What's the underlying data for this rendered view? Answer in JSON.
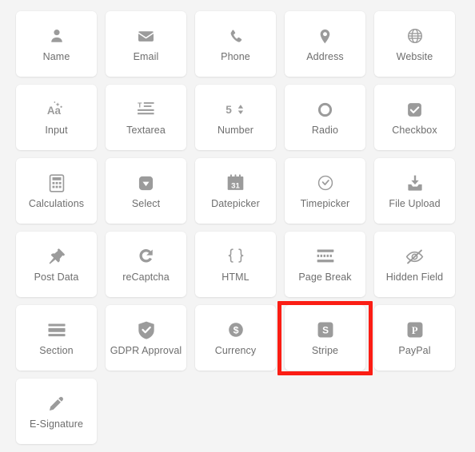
{
  "palette": {
    "page_background": "#f4f4f4",
    "card_background": "#ffffff",
    "icon_color": "#9b9b9b",
    "label_color": "#6e6e6e",
    "highlight_color": "#fb1d14"
  },
  "grid": {
    "columns": 5,
    "fields": [
      {
        "label": "Name",
        "icon": "person-icon"
      },
      {
        "label": "Email",
        "icon": "envelope-icon"
      },
      {
        "label": "Phone",
        "icon": "phone-icon"
      },
      {
        "label": "Address",
        "icon": "map-pin-icon"
      },
      {
        "label": "Website",
        "icon": "globe-icon"
      },
      {
        "label": "Input",
        "icon": "text-aa-icon"
      },
      {
        "label": "Textarea",
        "icon": "text-lines-icon"
      },
      {
        "label": "Number",
        "icon": "number-spinner-icon"
      },
      {
        "label": "Radio",
        "icon": "radio-circle-icon"
      },
      {
        "label": "Checkbox",
        "icon": "checkbox-icon"
      },
      {
        "label": "Calculations",
        "icon": "calculator-icon"
      },
      {
        "label": "Select",
        "icon": "dropdown-caret-icon"
      },
      {
        "label": "Datepicker",
        "icon": "calendar-31-icon"
      },
      {
        "label": "Timepicker",
        "icon": "clock-icon"
      },
      {
        "label": "File Upload",
        "icon": "upload-tray-icon"
      },
      {
        "label": "Post Data",
        "icon": "pushpin-icon"
      },
      {
        "label": "reCaptcha",
        "icon": "refresh-arrow-icon"
      },
      {
        "label": "HTML",
        "icon": "curly-braces-icon"
      },
      {
        "label": "Page Break",
        "icon": "page-break-icon"
      },
      {
        "label": "Hidden Field",
        "icon": "eye-slash-icon"
      },
      {
        "label": "Section",
        "icon": "section-bars-icon"
      },
      {
        "label": "GDPR Approval",
        "icon": "shield-check-icon"
      },
      {
        "label": "Currency",
        "icon": "dollar-coin-icon"
      },
      {
        "label": "Stripe",
        "icon": "stripe-logo-icon"
      },
      {
        "label": "PayPal",
        "icon": "paypal-logo-icon"
      },
      {
        "label": "E-Signature",
        "icon": "pencil-icon"
      }
    ]
  },
  "highlight": {
    "target_label": "Stripe"
  }
}
